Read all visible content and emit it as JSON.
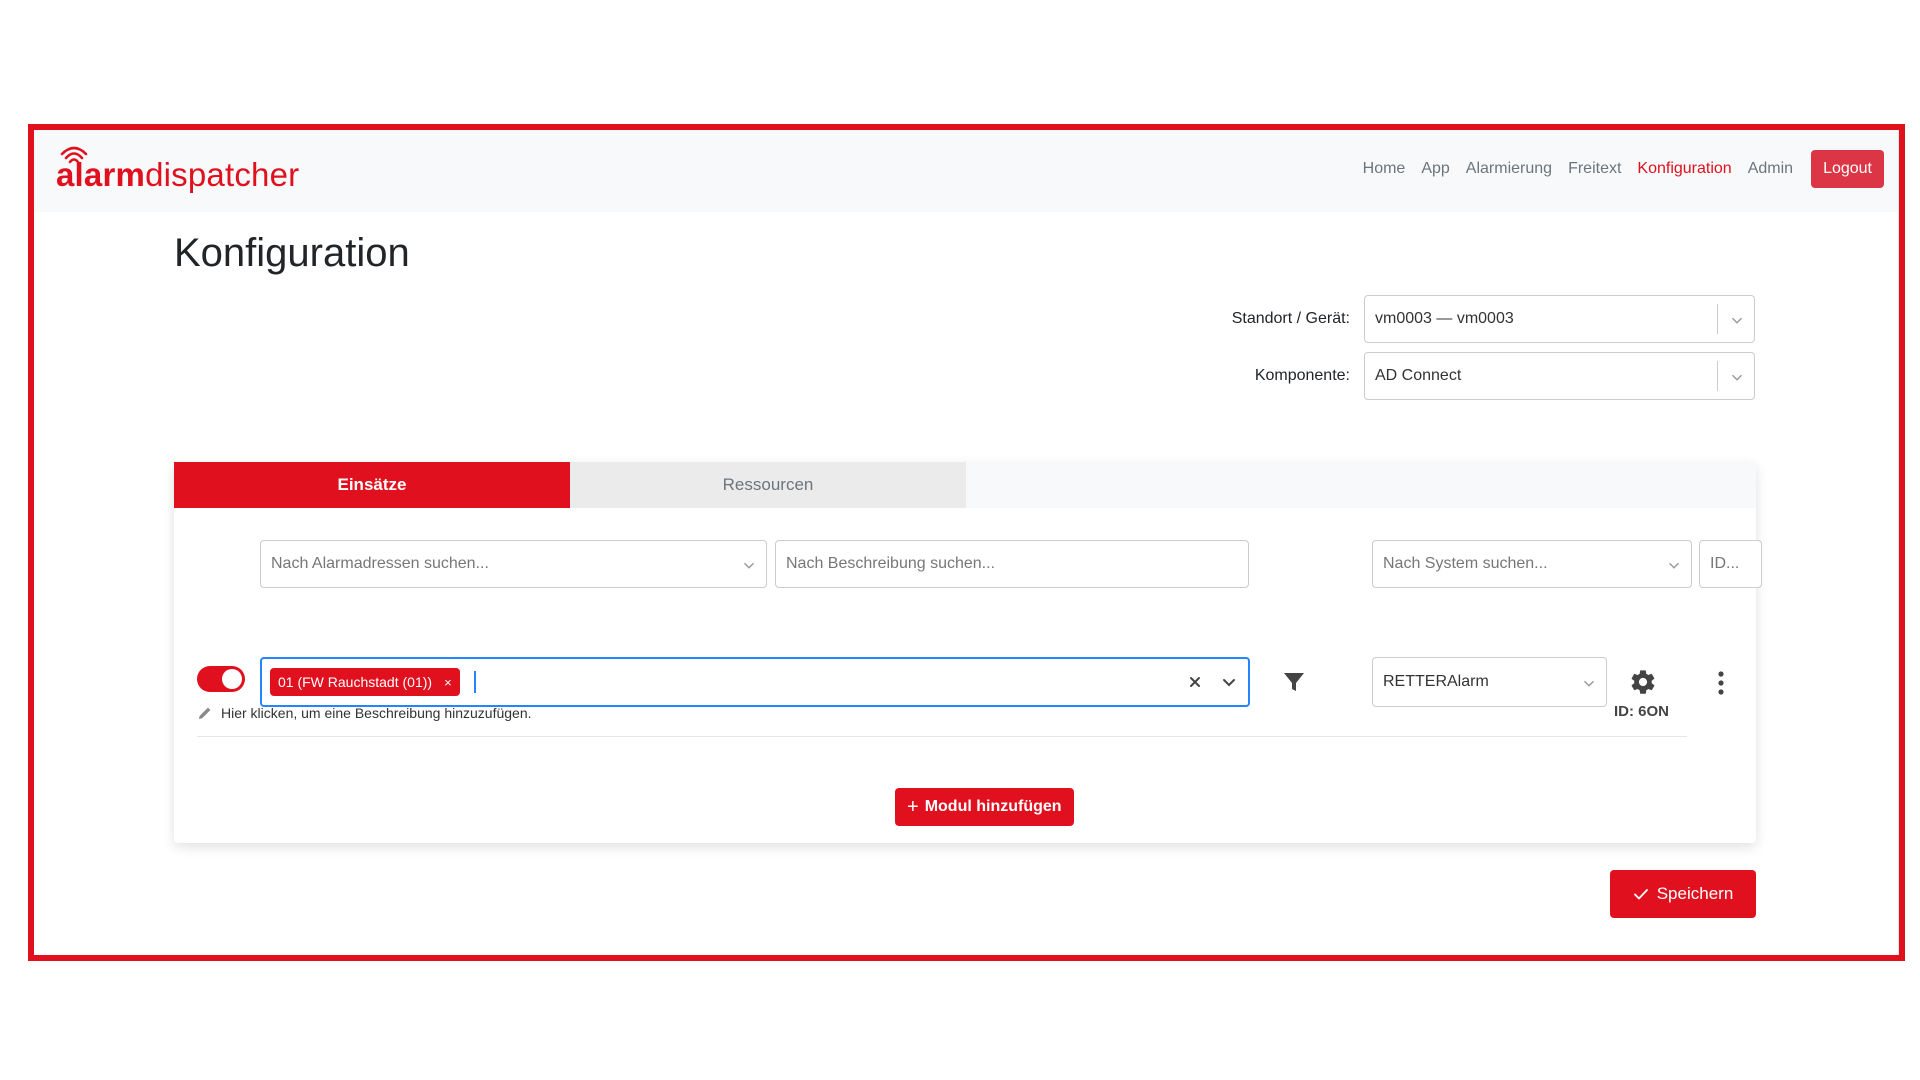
{
  "brand": {
    "logo_bold": "alarm",
    "logo_light": "dispatcher",
    "color": "#e0101e"
  },
  "nav": {
    "items": [
      {
        "label": "Home",
        "active": false
      },
      {
        "label": "App",
        "active": false
      },
      {
        "label": "Alarmierung",
        "active": false
      },
      {
        "label": "Freitext",
        "active": false
      },
      {
        "label": "Konfiguration",
        "active": true
      },
      {
        "label": "Admin",
        "active": false
      }
    ],
    "logout_label": "Logout"
  },
  "page": {
    "title": "Konfiguration"
  },
  "selectors": {
    "location": {
      "label": "Standort / Gerät:",
      "value": "vm0003 — vm0003"
    },
    "component": {
      "label": "Komponente:",
      "value": "AD Connect"
    }
  },
  "tabs": [
    {
      "label": "Einsätze",
      "active": true
    },
    {
      "label": "Ressourcen",
      "active": false
    }
  ],
  "filters": {
    "alarm_address_placeholder": "Nach Alarmadressen suchen...",
    "description_placeholder": "Nach Beschreibung suchen...",
    "system_placeholder": "Nach System suchen...",
    "id_placeholder": "ID..."
  },
  "module": {
    "enabled": true,
    "selected_chip": "01 (FW Rauchstadt (01))",
    "chip_remove": "×",
    "system_value": "RETTERAlarm",
    "id_label": "ID: 6ON",
    "description_hint": "Hier klicken, um eine Beschreibung hinzuzufügen."
  },
  "actions": {
    "add_module": "Modul hinzufügen",
    "save": "Speichern"
  },
  "icons": {
    "filter": "funnel-icon",
    "settings": "gear-icon",
    "more": "kebab-icon",
    "edit": "pencil-icon",
    "save": "check-icon",
    "add": "plus-icon"
  }
}
